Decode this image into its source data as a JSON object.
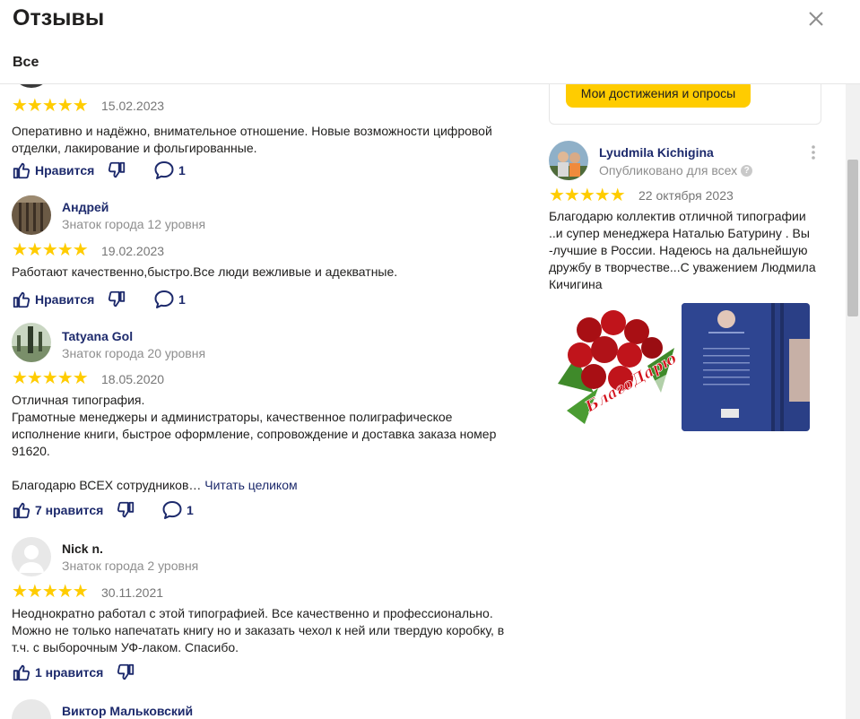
{
  "header": {
    "title": "Отзывы",
    "tab_all": "Все"
  },
  "colors": {
    "accent": "#1d2a6c",
    "star": "#ffcc00",
    "button": "#ffcc00",
    "muted": "#8e8e8e"
  },
  "reviews": [
    {
      "stars": "★★★★★",
      "date": "15.02.2023",
      "text": "Оперативно и надёжно, внимательное отношение. Новые возможности цифровой отделки, лакирование и фольгированные.",
      "like": "Нравится",
      "comments": "1"
    },
    {
      "name": "Андрей",
      "level": "Знаток города 12 уровня",
      "stars": "★★★★★",
      "date": "19.02.2023",
      "text": "Работают качественно,быстро.Все люди вежливые и адекватные.",
      "like": "Нравится",
      "comments": "1"
    },
    {
      "name": "Tatyana Gol",
      "level": "Знаток города 20 уровня",
      "stars": "★★★★★",
      "date": "18.05.2020",
      "text_lines": [
        "Отличная типография.",
        "Грамотные менеджеры и администраторы, качественное полиграфическое исполнение книги, быстрое оформление, сопровождение и доставка заказа номер 91620.",
        "",
        "Благодарю ВСЕХ сотрудников…"
      ],
      "more": "Читать целиком",
      "like": "7 нравится",
      "comments": "1"
    },
    {
      "name": "Nick n.",
      "level": "Знаток города 2 уровня",
      "stars": "★★★★★",
      "date": "30.11.2021",
      "text": "Неоднократно работал с этой типографией. Все качественно и профессионально. Можно не только напечатать книгу но и заказать чехол к ней или твердую коробку, в т.ч. с выборочным УФ-лаком. Спасибо.",
      "like": "1 нравится"
    },
    {
      "name": "Виктор Мальковский"
    }
  ],
  "sidebar": {
    "achievements_button": "Мои достижения и опросы",
    "review": {
      "name": "Lyudmila Kichigina",
      "published": "Опубликовано для всех",
      "stars": "★★★★★",
      "date": "22 октября 2023",
      "text": "Благодарю коллектив отличной типографии ..и супер менеджера Наталью Батурину . Вы -лучшие в России. Надеюсь на дальнейшую дружбу в творчестве...С уважением Людмила Кичигина",
      "photo_caption": "БлагоДарю от души!"
    }
  }
}
